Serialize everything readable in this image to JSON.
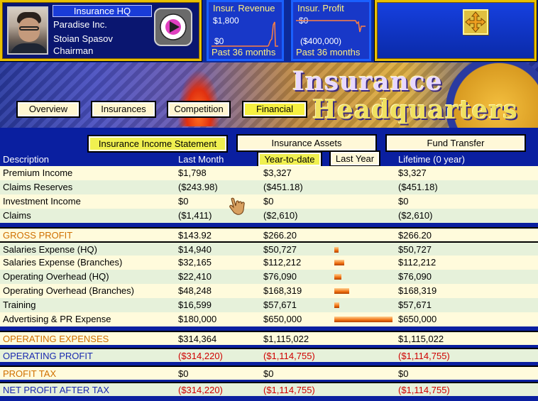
{
  "hud": {
    "hq_title": "Insurance HQ",
    "company": "Paradise Inc.",
    "person": "Stoian Spasov",
    "role": "Chairman",
    "revenue_graph": {
      "title": "Insur. Revenue",
      "top_value": "$1,800",
      "bottom_value": "$0",
      "footer": "Past 36 months"
    },
    "profit_graph": {
      "title": "Insur. Profit",
      "top_value": "$0",
      "bottom_value": "($400,000)",
      "footer": "Past 36 months"
    },
    "move_icon": "four-arrows-icon"
  },
  "banner": {
    "title_line1": "Insurance",
    "title_line2": "Headquarters",
    "tabs": [
      {
        "label": "Overview",
        "active": false
      },
      {
        "label": "Insurances",
        "active": false
      },
      {
        "label": "Competition",
        "active": false
      },
      {
        "label": "Financial",
        "active": true
      }
    ]
  },
  "report": {
    "buttons": {
      "income_statement": "Insurance Income Statement",
      "assets": "Insurance Assets",
      "fund_transfer": "Fund Transfer",
      "year_to_date": "Year-to-date",
      "last_year": "Last Year"
    },
    "columns": {
      "description": "Description",
      "last_month": "Last Month",
      "lifetime": "Lifetime  (0 year)"
    },
    "rows": [
      {
        "label": "Premium Income",
        "last_month": "$1,798",
        "ytd": "$3,327",
        "lifetime": "$3,327"
      },
      {
        "label": "Claims Reserves",
        "last_month": "($243.98)",
        "ytd": "($451.18)",
        "lifetime": "($451.18)"
      },
      {
        "label": "Investment Income",
        "last_month": "$0",
        "ytd": "$0",
        "lifetime": "$0"
      },
      {
        "label": "Claims",
        "last_month": "($1,411)",
        "ytd": "($2,610)",
        "lifetime": "($2,610)"
      },
      {
        "label": "GROSS PROFIT",
        "last_month": "$143.92",
        "ytd": "$266.20",
        "lifetime": "$266.20"
      },
      {
        "label": "Salaries Expense (HQ)",
        "last_month": "$14,940",
        "ytd": "$50,727",
        "lifetime": "$50,727",
        "share": 0.078
      },
      {
        "label": "Salaries Expense (Branches)",
        "last_month": "$32,165",
        "ytd": "$112,212",
        "lifetime": "$112,212",
        "share": 0.173
      },
      {
        "label": "Operating Overhead (HQ)",
        "last_month": "$22,410",
        "ytd": "$76,090",
        "lifetime": "$76,090",
        "share": 0.117
      },
      {
        "label": "Operating Overhead (Branches)",
        "last_month": "$48,248",
        "ytd": "$168,319",
        "lifetime": "$168,319",
        "share": 0.259
      },
      {
        "label": "Training",
        "last_month": "$16,599",
        "ytd": "$57,671",
        "lifetime": "$57,671",
        "share": 0.089
      },
      {
        "label": "Advertising & PR Expense",
        "last_month": "$180,000",
        "ytd": "$650,000",
        "lifetime": "$650,000",
        "share": 1.0
      },
      {
        "label": "OPERATING EXPENSES",
        "last_month": "$314,364",
        "ytd": "$1,115,022",
        "lifetime": "$1,115,022"
      },
      {
        "label": "OPERATING PROFIT",
        "last_month": "($314,220)",
        "ytd": "($1,114,755)",
        "lifetime": "($1,114,755)"
      },
      {
        "label": "PROFIT TAX",
        "last_month": "$0",
        "ytd": "$0",
        "lifetime": "$0"
      },
      {
        "label": "NET PROFIT AFTER TAX",
        "last_month": "($314,220)",
        "ytd": "($1,114,755)",
        "lifetime": "($1,114,755)"
      }
    ]
  },
  "colors": {
    "gold_frame": "#e8c000",
    "row_yellow": "#fffbdc",
    "row_green": "#e6f1da",
    "header_orange": "#d07000",
    "header_blue": "#1a2ab0",
    "negative_red": "#d00000",
    "active_button": "#f0f050"
  }
}
